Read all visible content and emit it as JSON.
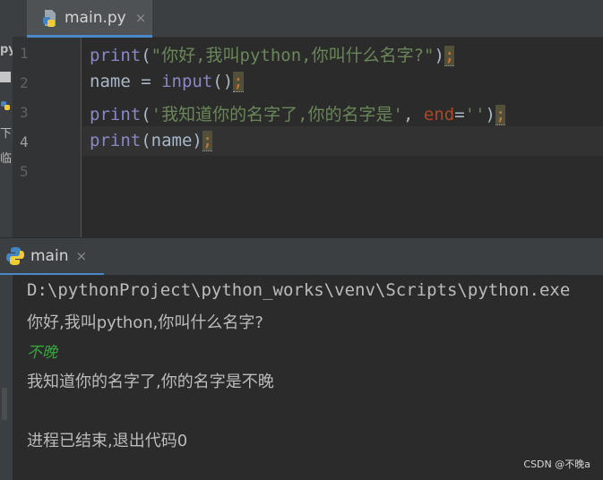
{
  "colors": {
    "background": "#2b2b2b",
    "tab_accent": "#4a88c7",
    "keyword_builtin": "#8888c6",
    "string": "#6a8759",
    "kw_arg": "#aa4926",
    "console_input": "#36a63d"
  },
  "project_panel_fragments": [
    "py",
    "下载",
    "临时"
  ],
  "editor": {
    "tab": {
      "label": "main.py",
      "close": "×",
      "icon": "python-file-icon"
    },
    "line_numbers": [
      "1",
      "2",
      "3",
      "4",
      "5"
    ],
    "lines": [
      {
        "fn": "print",
        "p1": "(",
        "s": "\"你好,我叫python,你叫什么名字?\"",
        "p2": ")",
        "semi": ";"
      },
      {
        "a": "name = ",
        "fn": "input",
        "p": "()",
        "semi": ";"
      },
      {
        "fn": "print",
        "p1": "(",
        "s": "'我知道你的名字了,你的名字是'",
        "c": ", ",
        "kw": "end",
        "eq": "=",
        "s2": "''",
        "p2": ")",
        "semi": ";"
      },
      {
        "fn": "print",
        "p": "(name)",
        "semi": ";"
      }
    ]
  },
  "run": {
    "tab": {
      "label": "main",
      "close": "×",
      "icon": "python-icon"
    },
    "console": [
      "D:\\pythonProject\\python_works\\venv\\Scripts\\python.exe",
      "你好,我叫python,你叫什么名字?",
      "不晚",
      "我知道你的名字了,你的名字是不晚",
      "进程已结束,退出代码0"
    ]
  },
  "watermark": "CSDN @不晚a"
}
